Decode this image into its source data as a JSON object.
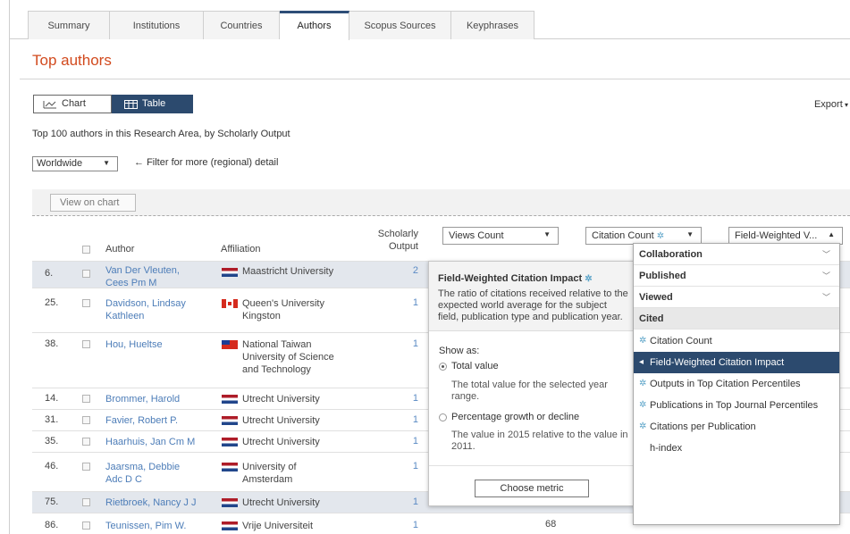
{
  "tabs": [
    "Summary",
    "Institutions",
    "Countries",
    "Authors",
    "Scopus Sources",
    "Keyphrases"
  ],
  "page_title": "Top authors",
  "view_toggle": {
    "chart": "Chart",
    "table": "Table"
  },
  "export_label": "Export",
  "description": "Top 100 authors in this Research Area, by Scholarly Output",
  "region_select": "Worldwide",
  "filter_hint": "Filter for more (regional) detail",
  "view_on_chart": "View on chart",
  "columns": {
    "author": "Author",
    "affiliation": "Affiliation",
    "output_1": "Scholarly",
    "output_2": "Output",
    "metric1": "Views Count",
    "metric2": "Citation Count",
    "metric3": "Field-Weighted V..."
  },
  "rows": [
    {
      "rank": "6.",
      "author_1": "Van Der Vleuten,",
      "author_2": "Cees Pm M",
      "aff_1": "Maastricht University",
      "aff_2": "",
      "aff_3": "",
      "output": "2",
      "flag": "nl"
    },
    {
      "rank": "25.",
      "author_1": "Davidson, Lindsay",
      "author_2": "Kathleen",
      "aff_1": "Queen's University",
      "aff_2": "Kingston",
      "aff_3": "",
      "output": "1",
      "flag": "ca"
    },
    {
      "rank": "38.",
      "author_1": "Hou, Hueltse",
      "author_2": "",
      "aff_1": "National Taiwan",
      "aff_2": "University of Science",
      "aff_3": "and Technology",
      "output": "1",
      "flag": "tw"
    },
    {
      "rank": "14.",
      "author_1": "Brommer, Harold",
      "author_2": "",
      "aff_1": "Utrecht University",
      "aff_2": "",
      "aff_3": "",
      "output": "1",
      "flag": "nl"
    },
    {
      "rank": "31.",
      "author_1": "Favier, Robert P.",
      "author_2": "",
      "aff_1": "Utrecht University",
      "aff_2": "",
      "aff_3": "",
      "output": "1",
      "flag": "nl"
    },
    {
      "rank": "35.",
      "author_1": "Haarhuis, Jan Cm M",
      "author_2": "",
      "aff_1": "Utrecht University",
      "aff_2": "",
      "aff_3": "",
      "output": "1",
      "flag": "nl"
    },
    {
      "rank": "46.",
      "author_1": "Jaarsma, Debbie",
      "author_2": "Adc D C",
      "aff_1": "University of",
      "aff_2": "Amsterdam",
      "aff_3": "",
      "output": "1",
      "flag": "nl"
    },
    {
      "rank": "75.",
      "author_1": "Rietbroek, Nancy J J",
      "author_2": "",
      "aff_1": "Utrecht University",
      "aff_2": "",
      "aff_3": "",
      "output": "1",
      "flag": "nl"
    },
    {
      "rank": "86.",
      "author_1": "Teunissen, Pim W.",
      "author_2": "",
      "aff_1": "Vrije Universiteit",
      "aff_2": "",
      "aff_3": "",
      "output": "1",
      "flag": "nl"
    }
  ],
  "bottom_views": "68",
  "tooltip": {
    "title": "Field-Weighted Citation Impact",
    "body": "The ratio of citations received relative to the expected world average for the subject field, publication type and publication year.",
    "show_as": "Show as:",
    "opt1": "Total value",
    "opt1_desc": "The total value for the selected year range.",
    "opt2": "Percentage growth or decline",
    "opt2_desc": "The value in 2015 relative to the value in 2011.",
    "button": "Choose metric"
  },
  "menu": {
    "groups": [
      "Collaboration",
      "Published",
      "Viewed",
      "Cited"
    ],
    "items": [
      "Citation Count",
      "Field-Weighted Citation Impact",
      "Outputs in Top Citation Percentiles",
      "Publications in Top Journal Percentiles",
      "Citations per Publication",
      "h-index"
    ]
  },
  "colors": {
    "accent": "#2c4a6e",
    "title": "#d24a1e",
    "link": "#4d7db8"
  }
}
